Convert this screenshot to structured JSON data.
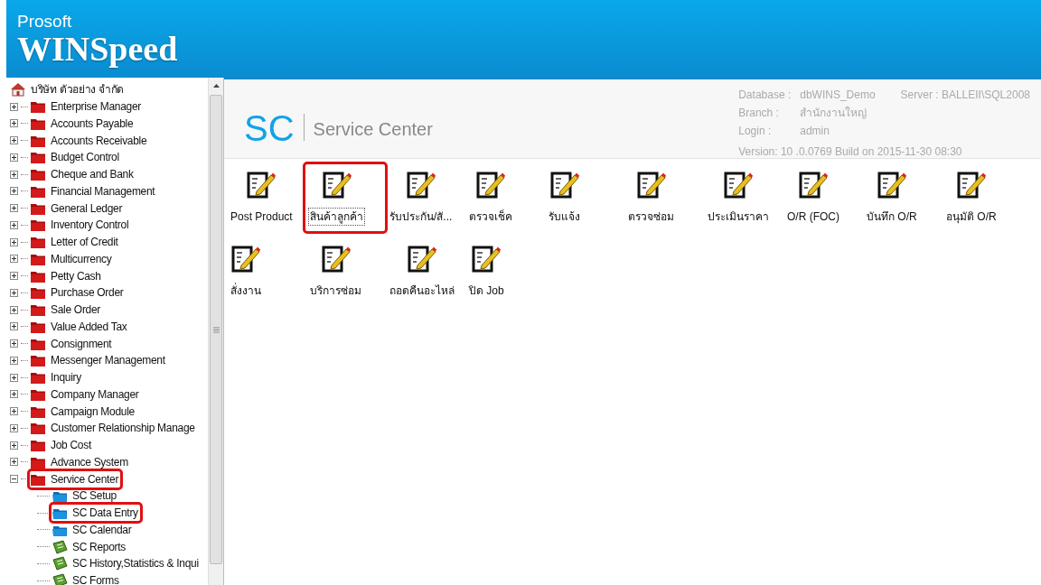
{
  "app_header": {
    "vendor": "Prosoft",
    "product": "WINSpeed"
  },
  "tree": {
    "root": {
      "label": "บริษัท ตัวอย่าง จำกัด",
      "kind": "home",
      "children": [
        {
          "label": "Enterprise Manager",
          "kind": "folder",
          "expanded": false,
          "highlighted": false
        },
        {
          "label": "Accounts Payable",
          "kind": "folder",
          "expanded": false,
          "highlighted": false
        },
        {
          "label": "Accounts Receivable",
          "kind": "folder",
          "expanded": false,
          "highlighted": false
        },
        {
          "label": "Budget Control",
          "kind": "folder",
          "expanded": false,
          "highlighted": false
        },
        {
          "label": "Cheque and Bank",
          "kind": "folder",
          "expanded": false,
          "highlighted": false
        },
        {
          "label": "Financial Management",
          "kind": "folder",
          "expanded": false,
          "highlighted": false
        },
        {
          "label": "General Ledger",
          "kind": "folder",
          "expanded": false,
          "highlighted": false
        },
        {
          "label": "Inventory Control",
          "kind": "folder",
          "expanded": false,
          "highlighted": false
        },
        {
          "label": "Letter of Credit",
          "kind": "folder",
          "expanded": false,
          "highlighted": false
        },
        {
          "label": "Multicurrency",
          "kind": "folder",
          "expanded": false,
          "highlighted": false
        },
        {
          "label": "Petty Cash",
          "kind": "folder",
          "expanded": false,
          "highlighted": false
        },
        {
          "label": "Purchase Order",
          "kind": "folder",
          "expanded": false,
          "highlighted": false
        },
        {
          "label": "Sale Order",
          "kind": "folder",
          "expanded": false,
          "highlighted": false
        },
        {
          "label": "Value Added Tax",
          "kind": "folder",
          "expanded": false,
          "highlighted": false
        },
        {
          "label": "Consignment",
          "kind": "folder",
          "expanded": false,
          "highlighted": false
        },
        {
          "label": "Messenger Management",
          "kind": "folder",
          "expanded": false,
          "highlighted": false
        },
        {
          "label": "Inquiry",
          "kind": "folder",
          "expanded": false,
          "highlighted": false
        },
        {
          "label": "Company Manager",
          "kind": "folder",
          "expanded": false,
          "highlighted": false
        },
        {
          "label": "Campaign Module",
          "kind": "folder",
          "expanded": false,
          "highlighted": false
        },
        {
          "label": "Customer Relationship Manage",
          "kind": "folder",
          "expanded": false,
          "highlighted": false
        },
        {
          "label": "Job Cost",
          "kind": "folder",
          "expanded": false,
          "highlighted": false
        },
        {
          "label": "Advance System",
          "kind": "folder",
          "expanded": false,
          "highlighted": false
        },
        {
          "label": "Service Center",
          "kind": "folder",
          "expanded": true,
          "highlighted": true,
          "children": [
            {
              "label": "SC Setup",
              "kind": "subfolder",
              "highlighted": false
            },
            {
              "label": "SC Data Entry",
              "kind": "subfolder",
              "highlighted": true
            },
            {
              "label": "SC Calendar",
              "kind": "subfolder",
              "highlighted": false
            },
            {
              "label": "SC Reports",
              "kind": "report",
              "highlighted": false
            },
            {
              "label": "SC History,Statistics & Inqui",
              "kind": "report",
              "highlighted": false
            },
            {
              "label": "SC Forms",
              "kind": "report",
              "highlighted": false
            }
          ]
        }
      ]
    }
  },
  "module_header": {
    "code": "SC",
    "title": "Service Center",
    "info": [
      {
        "label": "Database :",
        "value": "dbWINS_Demo"
      },
      {
        "label": "Branch :",
        "value": "สำนักงานใหญ่"
      },
      {
        "label": "Login :",
        "value": "admin"
      }
    ],
    "server": "Server : BALLEII\\SQL2008",
    "version": "Version: 10 .0.0769  Build on 2015-11-30 08:30"
  },
  "programs": [
    {
      "label": "Post Product",
      "selected": false,
      "highlighted": false
    },
    {
      "label": "สินค้าลูกค้า",
      "selected": true,
      "highlighted": true
    },
    {
      "label": "รับประกัน/สั...",
      "selected": false,
      "highlighted": false
    },
    {
      "label": "ตรวจเช็ค",
      "selected": false,
      "highlighted": false
    },
    {
      "label": "รับแจ้ง",
      "selected": false,
      "highlighted": false
    },
    {
      "label": "ตรวจซ่อม",
      "selected": false,
      "highlighted": false
    },
    {
      "label": "ประเมินราคา",
      "selected": false,
      "highlighted": false
    },
    {
      "label": "O/R (FOC)",
      "selected": false,
      "highlighted": false
    },
    {
      "label": "บันทึก O/R",
      "selected": false,
      "highlighted": false
    },
    {
      "label": "อนุมัติ O/R",
      "selected": false,
      "highlighted": false
    },
    {
      "label": "สั่งงาน",
      "selected": false,
      "highlighted": false
    },
    {
      "label": "บริการซ่อม",
      "selected": false,
      "highlighted": false
    },
    {
      "label": "ถอดคืนอะไหล่",
      "selected": false,
      "highlighted": false
    },
    {
      "label": "ปิด Job",
      "selected": false,
      "highlighted": false
    }
  ]
}
